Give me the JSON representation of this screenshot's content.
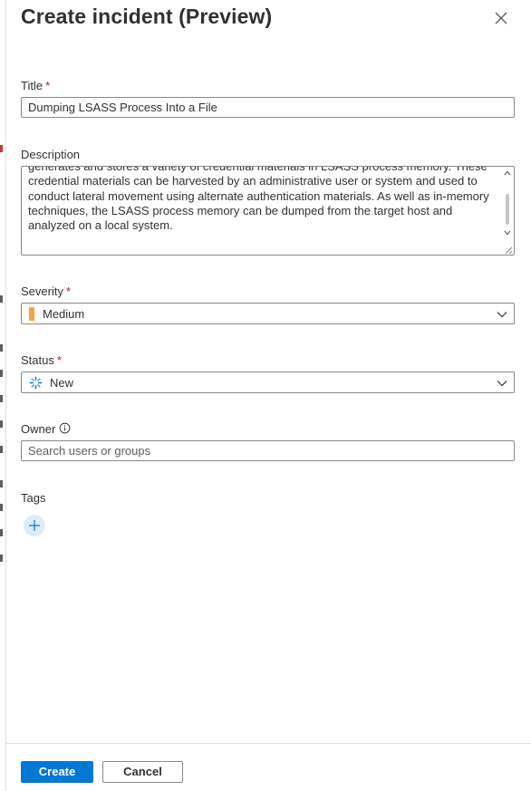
{
  "panel": {
    "title": "Create incident (Preview)"
  },
  "form": {
    "title": {
      "label": "Title",
      "required_mark": "*",
      "value": "Dumping LSASS Process Into a File"
    },
    "description": {
      "label": "Description",
      "lines": [
        "generates and stores a variety of credential materials in LSASS process memory. These",
        "credential materials can be harvested by an administrative user or system and used to",
        "conduct lateral movement using alternate authentication materials. As well as in-memory",
        "techniques, the LSASS process memory can be dumped from the target host and",
        "analyzed on a local system."
      ]
    },
    "severity": {
      "label": "Severity",
      "required_mark": "*",
      "value": "Medium",
      "color": "#f7a43c"
    },
    "status": {
      "label": "Status",
      "required_mark": "*",
      "value": "New",
      "icon": "new-status-spinner-icon"
    },
    "owner": {
      "label": "Owner",
      "placeholder": "Search users or groups"
    },
    "tags": {
      "label": "Tags"
    }
  },
  "footer": {
    "create_label": "Create",
    "cancel_label": "Cancel"
  },
  "colors": {
    "accent": "#0078d4",
    "required": "#a4262c",
    "border": "#8a8886"
  }
}
